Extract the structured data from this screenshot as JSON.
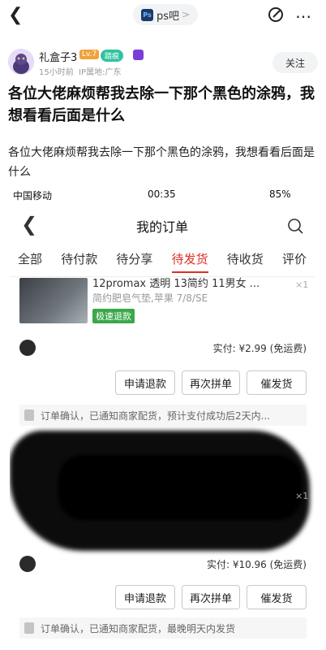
{
  "nav": {
    "forum_name": "ps吧",
    "forum_icon": "Ps",
    "chevron": ">"
  },
  "author": {
    "name": "礼盒子3",
    "level": "Lv.7",
    "badge": "踏痕",
    "time": "15小时前",
    "ip": "IP属地:广东",
    "follow_label": "关注"
  },
  "post": {
    "title": "各位大佬麻烦帮我去除一下那个黑色的涂鸦，我想看看后面是什么",
    "body": "各位大佬麻烦帮我去除一下那个黑色的涂鸦，我想看看后面是什么"
  },
  "shot": {
    "carrier": "中国移动",
    "time": "00:35",
    "battery": "85%",
    "page_title": "我的订单",
    "tabs": [
      "全部",
      "待付款",
      "待分享",
      "待发货",
      "待收货",
      "评价"
    ],
    "active_tab": 3,
    "order1": {
      "name": "12promax 透明 13简约 11男女 ...",
      "spec": "简约肥皂气垫,苹果 7/8/SE",
      "qty": "×1",
      "tag": "极速退款",
      "paid": "实付: ¥2.99 (免运费)",
      "notice": "订单确认，已通知商家配货，预计支付成功后2天内..."
    },
    "order2": {
      "qty": "×1",
      "paid": "实付: ¥10.96 (免运费)",
      "notice": "订单确认，已通知商家配货，最晚明天内发货"
    },
    "buttons": [
      "申请退款",
      "再次拼单",
      "催发货"
    ]
  }
}
